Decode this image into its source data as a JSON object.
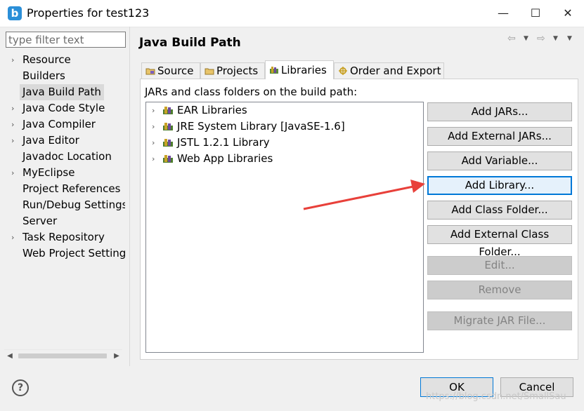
{
  "window": {
    "title": "Properties for test123",
    "minimize": "—",
    "maximize": "☐",
    "close": "✕"
  },
  "filter": {
    "placeholder": "type filter text",
    "value": ""
  },
  "tree": {
    "items": [
      {
        "label": "Resource",
        "expandable": true
      },
      {
        "label": "Builders",
        "expandable": false
      },
      {
        "label": "Java Build Path",
        "expandable": false,
        "selected": true
      },
      {
        "label": "Java Code Style",
        "expandable": true
      },
      {
        "label": "Java Compiler",
        "expandable": true
      },
      {
        "label": "Java Editor",
        "expandable": true
      },
      {
        "label": "Javadoc Location",
        "expandable": false
      },
      {
        "label": "MyEclipse",
        "expandable": true
      },
      {
        "label": "Project References",
        "expandable": false
      },
      {
        "label": "Run/Debug Settings",
        "expandable": false
      },
      {
        "label": "Server",
        "expandable": false
      },
      {
        "label": "Task Repository",
        "expandable": true
      },
      {
        "label": "Web Project Settings",
        "expandable": false
      }
    ]
  },
  "page": {
    "title": "Java Build Path",
    "nav_back": "⇦",
    "nav_forward": "⇨",
    "nav_menu": "▼"
  },
  "tabs": [
    {
      "label": "Source",
      "icon": "source-folder-icon"
    },
    {
      "label": "Projects",
      "icon": "projects-icon"
    },
    {
      "label": "Libraries",
      "icon": "libraries-icon",
      "active": true
    },
    {
      "label": "Order and Export",
      "icon": "order-export-icon"
    }
  ],
  "libraries": {
    "heading": "JARs and class folders on the build path:",
    "items": [
      {
        "label": "EAR Libraries"
      },
      {
        "label": "JRE System Library [JavaSE-1.6]"
      },
      {
        "label": "JSTL 1.2.1 Library"
      },
      {
        "label": "Web App Libraries"
      }
    ]
  },
  "buttons": {
    "add_jars": "Add JARs...",
    "add_external_jars": "Add External JARs...",
    "add_variable": "Add Variable...",
    "add_library": "Add Library...",
    "add_class_folder": "Add Class Folder...",
    "add_external_class_folder": "Add External Class Folder...",
    "edit": "Edit...",
    "remove": "Remove",
    "migrate_jar": "Migrate JAR File..."
  },
  "footer": {
    "help": "?",
    "ok": "OK",
    "cancel": "Cancel"
  },
  "watermark": "https://blog.csdn.net/SmallSau",
  "colors": {
    "accent": "#0078d7",
    "annotation_arrow": "#e8403a",
    "selection": "#dadada"
  }
}
